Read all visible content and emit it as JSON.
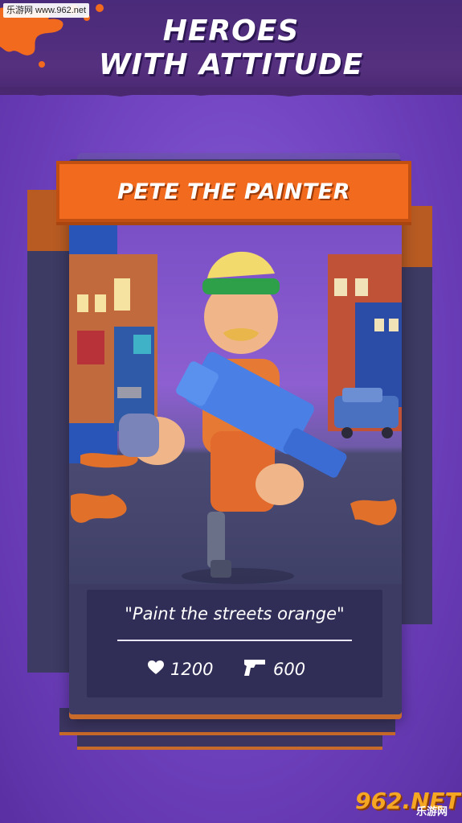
{
  "watermark_top": "乐游网 www.962.net",
  "headline": {
    "line1": "HEROES",
    "line2": "WITH ATTITUDE"
  },
  "hero": {
    "name": "PETE THE PAINTER",
    "quote": "\"Paint the streets orange\"",
    "health": "1200",
    "damage": "600"
  },
  "icons": {
    "health": "heart-icon",
    "damage": "gun-icon"
  },
  "watermark_br": {
    "logo": "962.NET",
    "sub": "乐游网"
  },
  "colors": {
    "background": "#7446c4",
    "accent_orange": "#f26a1e",
    "panel": "#302e56"
  }
}
